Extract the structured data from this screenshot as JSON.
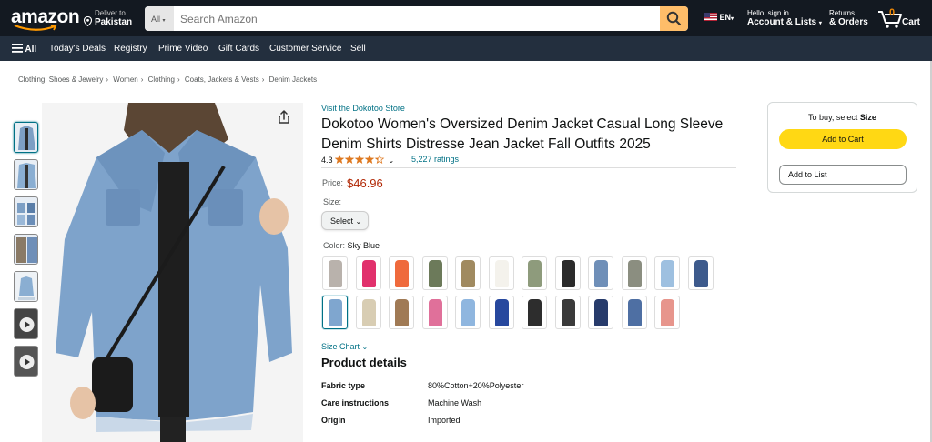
{
  "header": {
    "logo": "amazon",
    "deliver_line1": "Deliver to",
    "deliver_line2": "Pakistan",
    "search_category": "All",
    "search_placeholder": "Search Amazon",
    "language": "EN",
    "account_line1": "Hello, sign in",
    "account_line2": "Account & Lists",
    "returns_line1": "Returns",
    "returns_line2": "& Orders",
    "cart_count": "0",
    "cart_label": "Cart"
  },
  "nav": {
    "all": "All",
    "items": [
      "Today's Deals",
      "Registry",
      "Prime Video",
      "Gift Cards",
      "Customer Service",
      "Sell"
    ]
  },
  "breadcrumb": [
    "Clothing, Shoes & Jewelry",
    "Women",
    "Clothing",
    "Coats, Jackets & Vests",
    "Denim Jackets"
  ],
  "product": {
    "store_link": "Visit the Dokotoo Store",
    "title": "Dokotoo Women's Oversized Denim Jacket Casual Long Sleeve Denim Shirts Distresse Jean Jacket Fall Outfits 2025",
    "rating": "4.3",
    "ratings_count": "5,227 ratings",
    "price_label": "Price:",
    "price": "$46.96",
    "size_label": "Size:",
    "size_value": "Select",
    "color_label": "Color:",
    "color_value": "Sky Blue",
    "size_chart": "Size Chart",
    "swatch_colors": [
      "#b9b2ac",
      "#e1306c",
      "#ef6a3c",
      "#6c7a5a",
      "#a08a60",
      "#f4f2ec",
      "#8e9b7c",
      "#2b2b2b",
      "#6f8fb8",
      "#8b8e80",
      "#9ec0e0",
      "#3d5a8c",
      "#7fa6cf",
      "#d8cdb3",
      "#a07a55",
      "#e0709a",
      "#8fb6df",
      "#27489e",
      "#2d2d2d",
      "#3a3a3a",
      "#273b6b",
      "#4e6fa3",
      "#e7958c"
    ],
    "details_title": "Product details",
    "details": [
      {
        "key": "Fabric type",
        "value": "80%Cotton+20%Polyester"
      },
      {
        "key": "Care instructions",
        "value": "Machine Wash"
      },
      {
        "key": "Origin",
        "value": "Imported"
      }
    ]
  },
  "buybox": {
    "title_prefix": "To buy, select ",
    "title_bold": "Size",
    "add_to_cart": "Add to Cart",
    "add_to_list": "Add to List"
  },
  "colors": {
    "topbar": "#131921",
    "navbar": "#232f3e",
    "search_button": "#febd69",
    "add_to_cart": "#ffd814",
    "price": "#b12704",
    "link": "#007185",
    "star": "#de7921"
  }
}
